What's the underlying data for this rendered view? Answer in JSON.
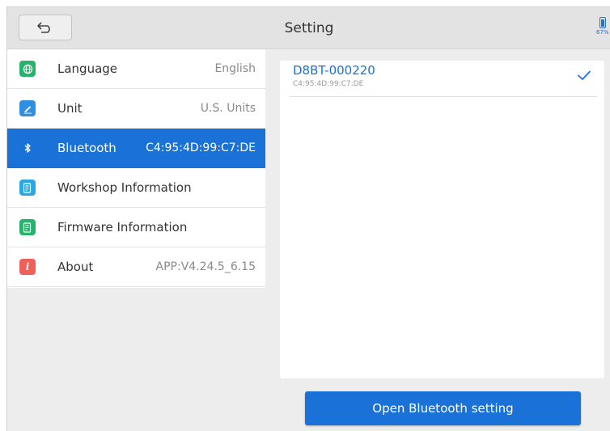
{
  "header": {
    "title": "Setting",
    "battery_percent_text": "67%",
    "battery_level": 0.67
  },
  "sidebar": {
    "items": [
      {
        "label": "Language",
        "value": "English",
        "icon": "globe-icon",
        "icon_color": "#27b36b"
      },
      {
        "label": "Unit",
        "value": "U.S. Units",
        "icon": "pencil-icon",
        "icon_color": "#2f8fe0"
      },
      {
        "label": "Bluetooth",
        "value": "C4:95:4D:99:C7:DE",
        "icon": "bluetooth-icon",
        "icon_color": "#1a72d9",
        "active": true
      },
      {
        "label": "Workshop Information",
        "value": "",
        "icon": "document-icon",
        "icon_color": "#2aa8e0"
      },
      {
        "label": "Firmware Information",
        "value": "",
        "icon": "document-icon",
        "icon_color": "#27b36b"
      },
      {
        "label": "About",
        "value": "APP:V4.24.5_6.15",
        "icon": "info-icon",
        "icon_color": "#f0605a"
      }
    ]
  },
  "devices": [
    {
      "name": "D8BT-000220",
      "address": "C4:95:4D:99:C7:DE",
      "connected": true
    }
  ],
  "actions": {
    "open_bluetooth_label": "Open Bluetooth setting"
  },
  "colors": {
    "accent": "#1a72d9",
    "background": "#ededed"
  }
}
